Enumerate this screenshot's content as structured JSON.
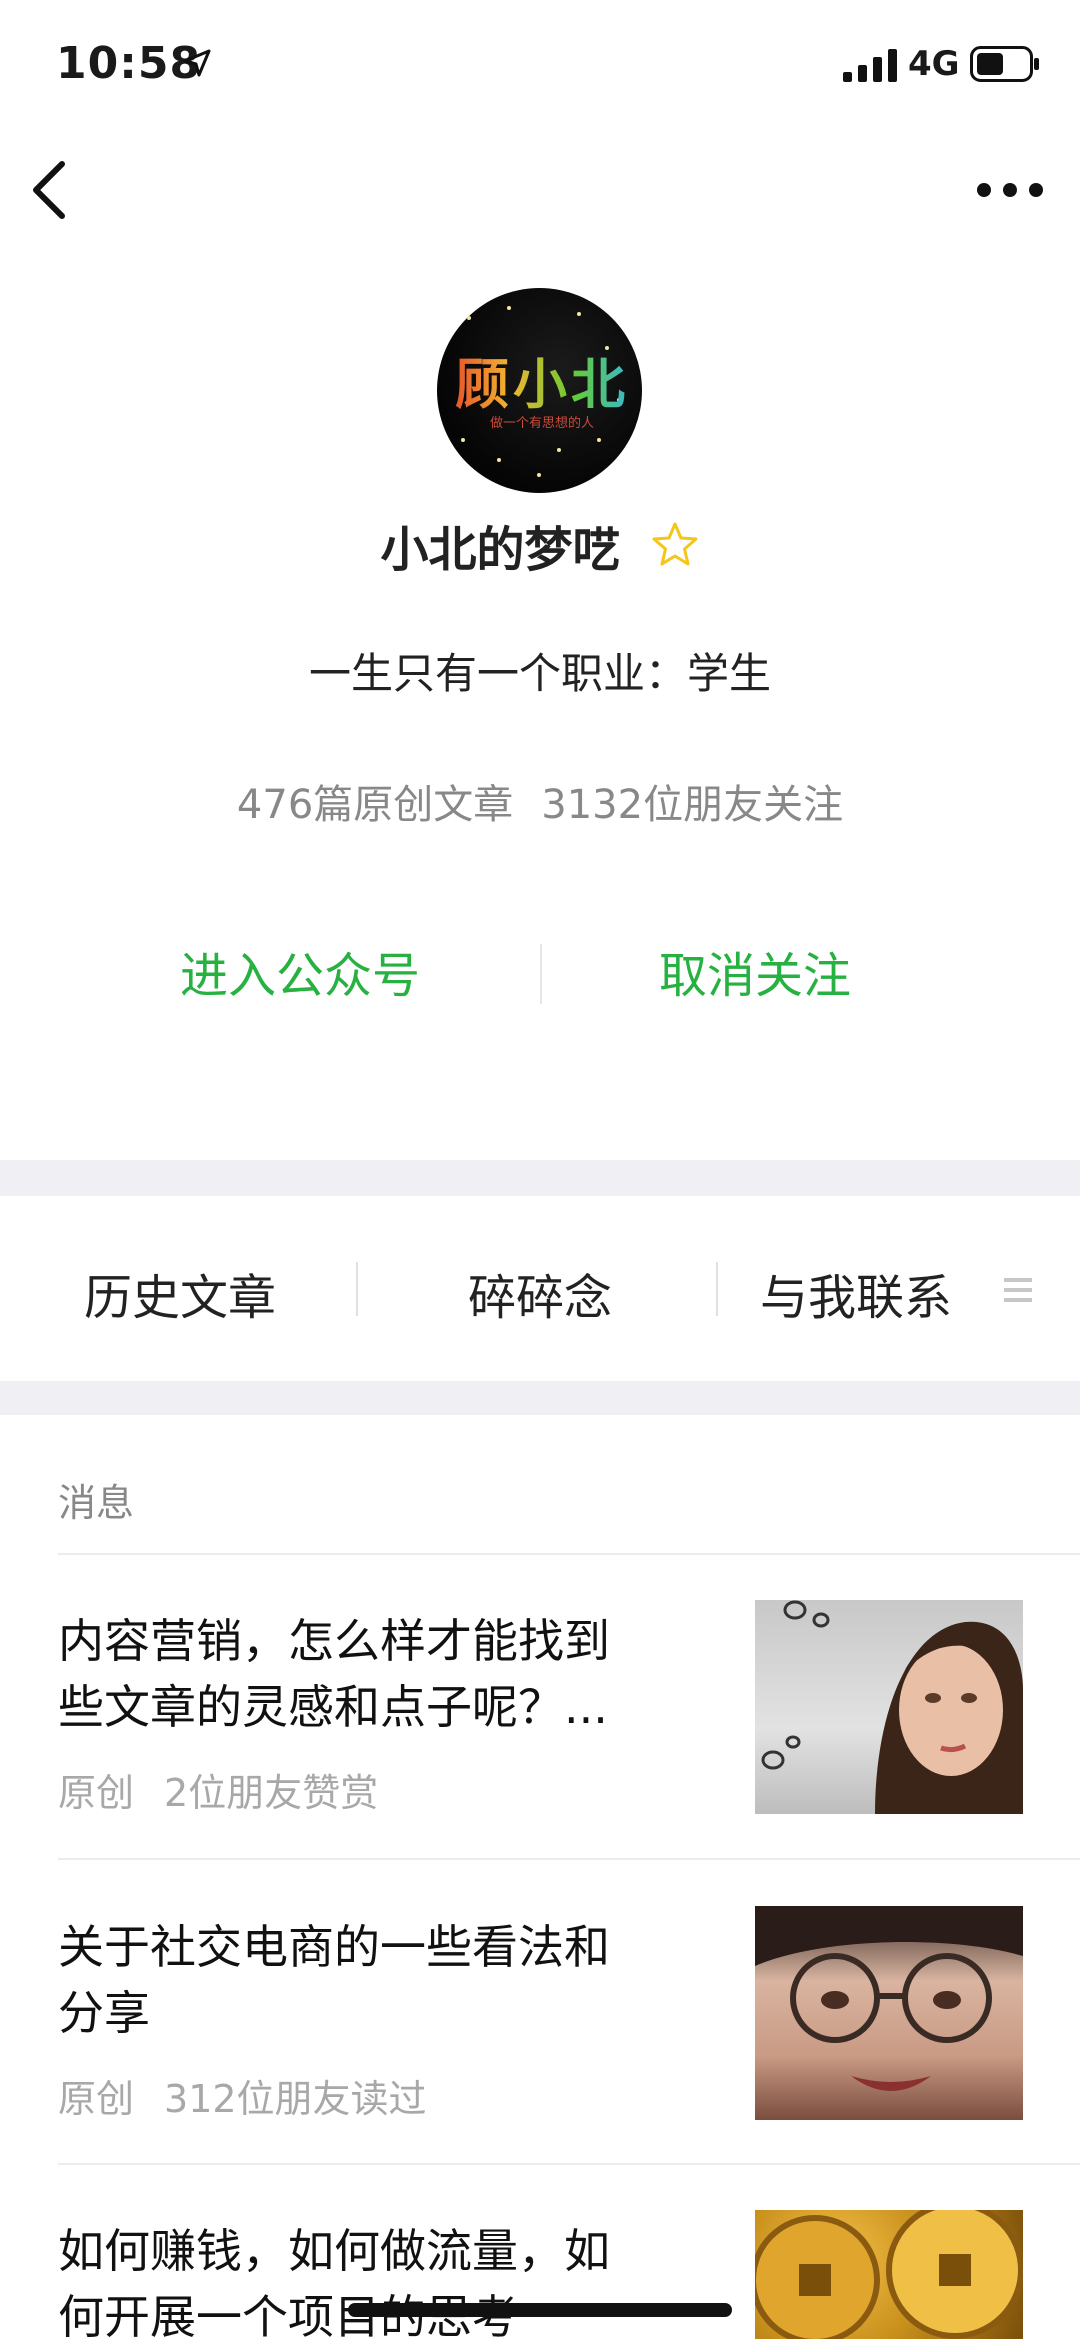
{
  "status_bar": {
    "time": "10:58",
    "network": "4G"
  },
  "profile": {
    "avatar_text": "顾小北",
    "avatar_subtext": "做一个有思想的人",
    "name": "小北的梦呓",
    "bio": "一生只有一个职业：学生",
    "stats": {
      "articles": "476篇原创文章",
      "followers": "3132位朋友关注"
    },
    "actions": {
      "enter": "进入公众号",
      "unfollow": "取消关注"
    }
  },
  "menu": {
    "items": [
      "历史文章",
      "碎碎念",
      "与我联系"
    ]
  },
  "messages": {
    "title": "消息",
    "articles": [
      {
        "title_line1": "内容营销，怎么样才能找到",
        "title_line2": "些文章的灵感和点子呢？...",
        "tag": "原创",
        "meta": "2位朋友赞赏"
      },
      {
        "title_line1": "关于社交电商的一些看法和",
        "title_line2": "分享",
        "tag": "原创",
        "meta": "312位朋友读过"
      },
      {
        "title_line1": "如何赚钱，如何做流量，如",
        "title_line2": "何开展一个项目的思考"
      }
    ]
  },
  "colors": {
    "accent": "#27b140",
    "star": "#f5c518",
    "band": "#efeff4"
  }
}
